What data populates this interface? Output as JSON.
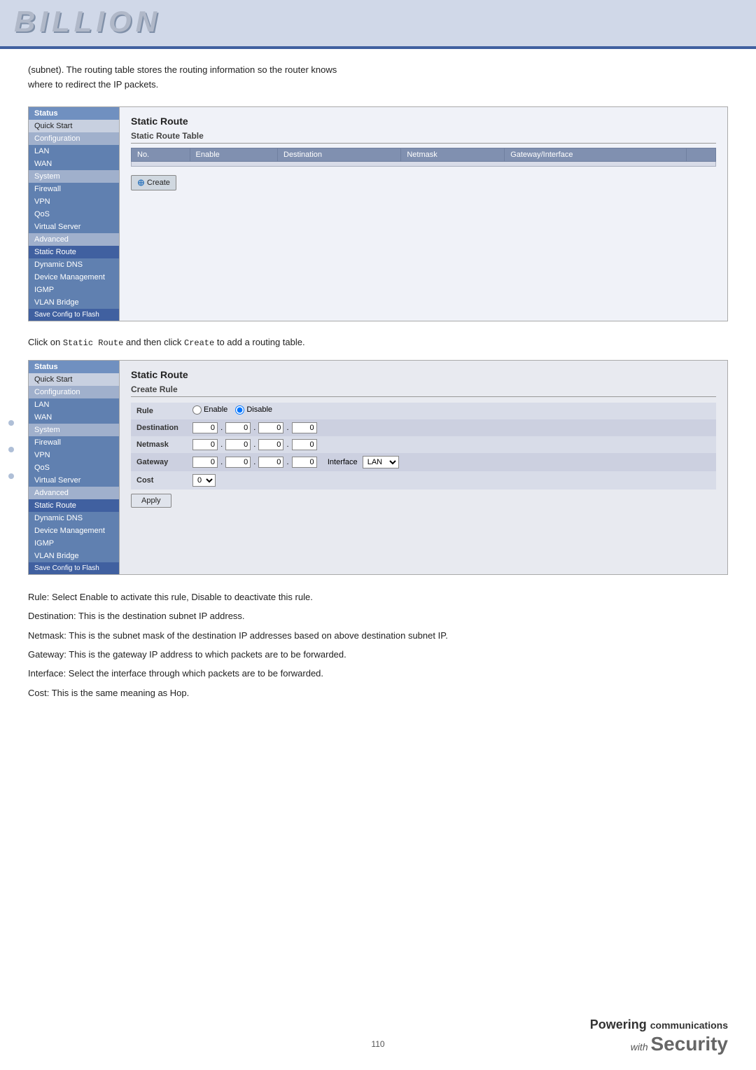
{
  "header": {
    "logo": "BILLION"
  },
  "intro": {
    "line1": "(subnet). The routing table stores the routing information so the router knows",
    "line2": "where to redirect the IP packets."
  },
  "sidebar1": {
    "items": [
      {
        "label": "Status",
        "class": "section-header"
      },
      {
        "label": "Quick Start",
        "class": ""
      },
      {
        "label": "Configuration",
        "class": "subsection"
      },
      {
        "label": "LAN",
        "class": "highlighted"
      },
      {
        "label": "WAN",
        "class": "highlighted"
      },
      {
        "label": "System",
        "class": "subsection"
      },
      {
        "label": "Firewall",
        "class": "highlighted"
      },
      {
        "label": "VPN",
        "class": "highlighted"
      },
      {
        "label": "QoS",
        "class": "highlighted"
      },
      {
        "label": "Virtual Server",
        "class": "highlighted"
      },
      {
        "label": "Advanced",
        "class": "subsection"
      },
      {
        "label": "Static Route",
        "class": "active"
      },
      {
        "label": "Dynamic DNS",
        "class": "highlighted"
      },
      {
        "label": "Device Management",
        "class": "highlighted"
      },
      {
        "label": "IGMP",
        "class": "highlighted"
      },
      {
        "label": "VLAN Bridge",
        "class": "highlighted"
      },
      {
        "label": "Save Config to Flash",
        "class": "save-config"
      }
    ]
  },
  "panel1": {
    "title": "Static Route",
    "subtitle": "Static Route Table",
    "table": {
      "headers": [
        "No.",
        "Enable",
        "Destination",
        "Netmask",
        "Gateway/Interface"
      ],
      "rows": []
    },
    "create_btn": "Create"
  },
  "between_text": {
    "text": "Click on Static Route and then click Create to add a routing table."
  },
  "sidebar2": {
    "items": [
      {
        "label": "Status",
        "class": "section-header"
      },
      {
        "label": "Quick Start",
        "class": ""
      },
      {
        "label": "Configuration",
        "class": "subsection"
      },
      {
        "label": "LAN",
        "class": "highlighted"
      },
      {
        "label": "WAN",
        "class": "highlighted"
      },
      {
        "label": "System",
        "class": "subsection"
      },
      {
        "label": "Firewall",
        "class": "highlighted"
      },
      {
        "label": "VPN",
        "class": "highlighted"
      },
      {
        "label": "QoS",
        "class": "highlighted"
      },
      {
        "label": "Virtual Server",
        "class": "highlighted"
      },
      {
        "label": "Advanced",
        "class": "subsection"
      },
      {
        "label": "Static Route",
        "class": "active"
      },
      {
        "label": "Dynamic DNS",
        "class": "highlighted"
      },
      {
        "label": "Device Management",
        "class": "highlighted"
      },
      {
        "label": "IGMP",
        "class": "highlighted"
      },
      {
        "label": "VLAN Bridge",
        "class": "highlighted"
      },
      {
        "label": "Save Config to Flash",
        "class": "save-config"
      }
    ]
  },
  "panel2": {
    "title": "Static Route",
    "subtitle": "Create Rule",
    "form": {
      "rule_label": "Rule",
      "enable_label": "Enable",
      "disable_label": "Disable",
      "destination_label": "Destination",
      "netmask_label": "Netmask",
      "gateway_label": "Gateway",
      "cost_label": "Cost",
      "interface_label": "Interface",
      "interface_value": "LAN",
      "cost_value": "0",
      "ip_defaults": [
        "0",
        "0",
        "0",
        "0"
      ],
      "apply_btn": "Apply"
    }
  },
  "descriptions": {
    "rule": "Rule: Select Enable to activate this rule, Disable to deactivate this rule.",
    "destination": "Destination: This is the destination subnet IP address.",
    "netmask": "Netmask: This is the subnet mask of the destination IP addresses based on above destination subnet IP.",
    "gateway": "Gateway: This is the gateway IP address to which packets are to be forwarded.",
    "interface": "Interface: Select the interface through which packets are to be forwarded.",
    "cost": "Cost: This is the same meaning as Hop."
  },
  "footer": {
    "page_number": "110",
    "brand_powering": "Powering",
    "brand_communications": "communications",
    "brand_with": "with",
    "brand_security": "Security"
  }
}
